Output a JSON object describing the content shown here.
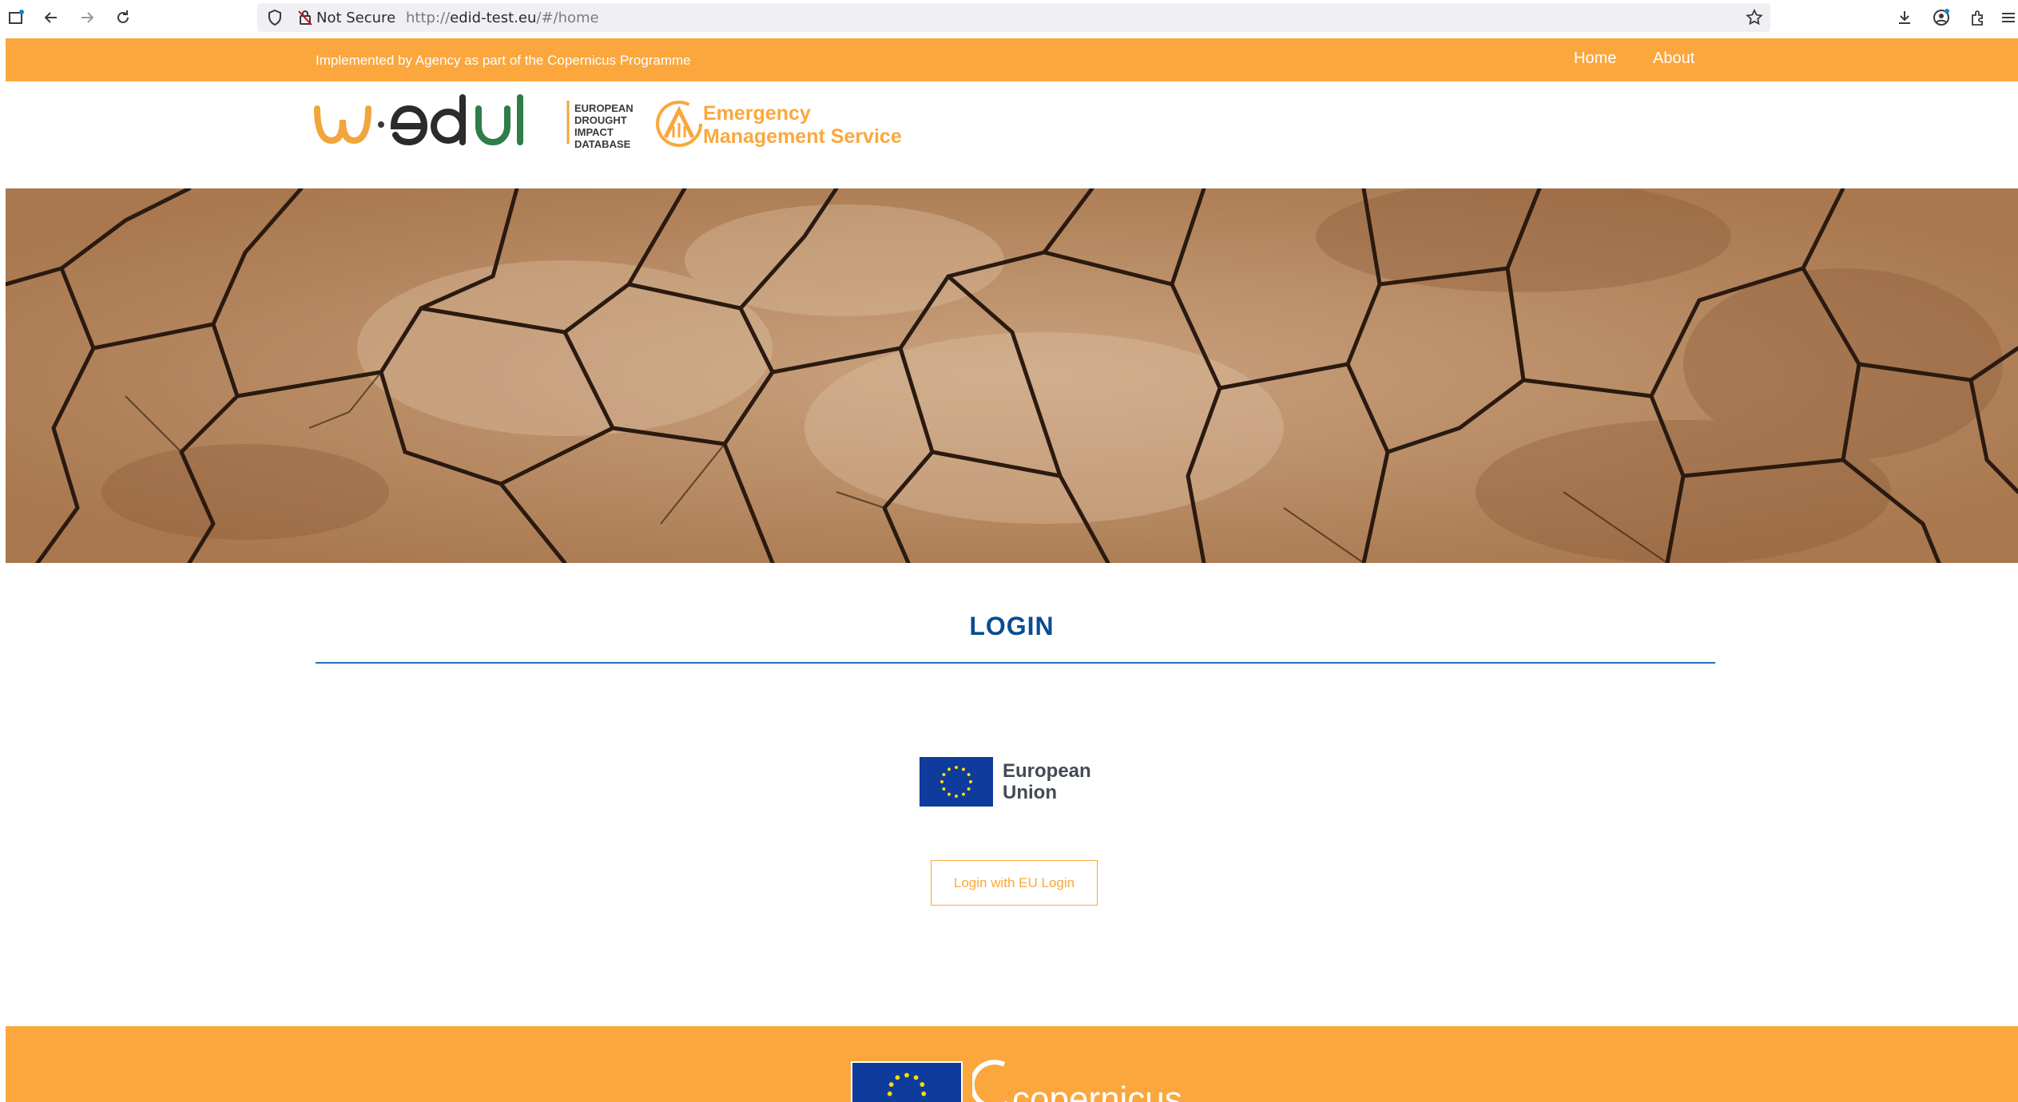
{
  "browser": {
    "security_label": "Not Secure",
    "url_prefix": "http://",
    "url_host": "edid-test.eu",
    "url_path": "/#/home"
  },
  "topbar": {
    "tagline": "Implemented by Agency as part of the Copernicus Programme",
    "nav": [
      {
        "label": "Home"
      },
      {
        "label": "About"
      }
    ]
  },
  "header": {
    "logo_text": "w·edid",
    "logo_subtitle": [
      "EUROPEAN",
      "DROUGHT",
      "IMPACT",
      "DATABASE"
    ],
    "ems_line1": "Emergency",
    "ems_line2": "Management Service"
  },
  "login": {
    "title": "LOGIN",
    "eu_line1": "European",
    "eu_line2": "Union",
    "button_label": "Login with EU Login"
  },
  "footer": {
    "copernicus_text": "copernicus"
  },
  "colors": {
    "accent": "#fba73d",
    "title_blue": "#0a4c94",
    "eu_blue": "#0e3b9c",
    "eu_star": "#ffdd00"
  }
}
